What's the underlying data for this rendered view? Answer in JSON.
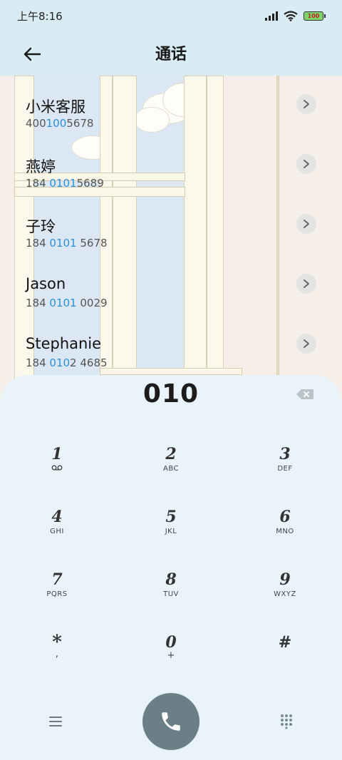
{
  "status_bar": {
    "time": "上午8:16",
    "battery": "100",
    "icons": [
      "signal-icon",
      "wifi-icon",
      "battery-icon"
    ]
  },
  "header": {
    "title": "通话",
    "back_icon": "arrow-left-icon"
  },
  "contacts": [
    {
      "name": "小米客服",
      "number_pre": "400",
      "number_hl": "100",
      "number_post": "5678"
    },
    {
      "name": "燕婷",
      "number_pre": "184 ",
      "number_hl": "0101",
      "number_post": "5689"
    },
    {
      "name": "子玲",
      "number_pre": "184 ",
      "number_hl": "0101",
      "number_post": " 5678"
    },
    {
      "name": "Jason",
      "number_pre": "184 ",
      "number_hl": "0101",
      "number_post": " 0029"
    },
    {
      "name": "Stephanie",
      "number_pre": "184 ",
      "number_hl": "010",
      "number_post": "2 4685"
    }
  ],
  "dialpad": {
    "input": "010",
    "keys": [
      {
        "digit": "1",
        "letters": "",
        "sub": "voicemail"
      },
      {
        "digit": "2",
        "letters": "ABC",
        "sub": ""
      },
      {
        "digit": "3",
        "letters": "DEF",
        "sub": ""
      },
      {
        "digit": "4",
        "letters": "GHI",
        "sub": ""
      },
      {
        "digit": "5",
        "letters": "JKL",
        "sub": ""
      },
      {
        "digit": "6",
        "letters": "MNO",
        "sub": ""
      },
      {
        "digit": "7",
        "letters": "PQRS",
        "sub": ""
      },
      {
        "digit": "8",
        "letters": "TUV",
        "sub": ""
      },
      {
        "digit": "9",
        "letters": "WXYZ",
        "sub": ""
      },
      {
        "digit": "*",
        "letters": ",",
        "sub": ""
      },
      {
        "digit": "0",
        "letters": "+",
        "sub": ""
      },
      {
        "digit": "#",
        "letters": "",
        "sub": ""
      }
    ]
  },
  "colors": {
    "header_bg": "#d9ecf4",
    "dialpad_bg": "#e8f3fa",
    "highlight": "#2a8fd6",
    "call_button": "#6b8086"
  }
}
